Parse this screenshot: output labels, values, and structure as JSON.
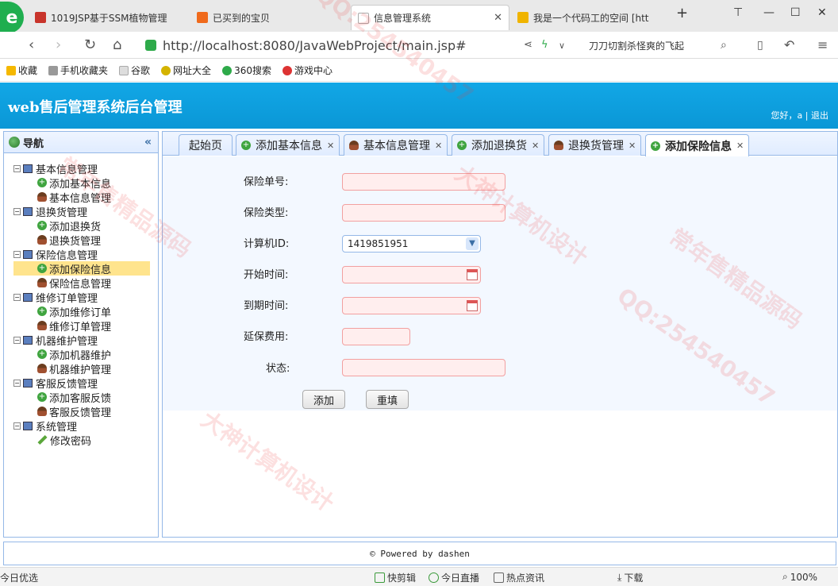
{
  "browser": {
    "tabs": [
      {
        "label": "1019JSP基于SSM植物管理",
        "color": "#c8342b"
      },
      {
        "label": "已买到的宝贝",
        "color": "#f06a1c"
      },
      {
        "label": "信息管理系统",
        "color": "#bbbbbb"
      },
      {
        "label": "我是一个代码工的空间 [htt",
        "color": "#f0b400"
      }
    ],
    "url": "http://localhost:8080/JavaWebProject/main.jsp#",
    "search_text": "刀刀切割杀怪爽的飞起"
  },
  "bookmarks": [
    {
      "label": "收藏",
      "color": "#f5b800"
    },
    {
      "label": "手机收藏夹",
      "color": "#999999"
    },
    {
      "label": "谷歌",
      "color": "#aaaaaa"
    },
    {
      "label": "网址大全",
      "color": "#d4b300"
    },
    {
      "label": "360搜索",
      "color": "#2eaa4a"
    },
    {
      "label": "游戏中心",
      "color": "#d33"
    }
  ],
  "app": {
    "title": "web售后管理系统后台管理",
    "user_greeting": "您好，a",
    "logout": "退出"
  },
  "sidebar": {
    "title": "导航",
    "collapse": "«",
    "groups": [
      {
        "label": "基本信息管理",
        "items": [
          "添加基本信息",
          "基本信息管理"
        ]
      },
      {
        "label": "退换货管理",
        "items": [
          "添加退换货",
          "退换货管理"
        ]
      },
      {
        "label": "保险信息管理",
        "items": [
          "添加保险信息",
          "保险信息管理"
        ]
      },
      {
        "label": "维修订单管理",
        "items": [
          "添加维修订单",
          "维修订单管理"
        ]
      },
      {
        "label": "机器维护管理",
        "items": [
          "添加机器维护",
          "机器维护管理"
        ]
      },
      {
        "label": "客服反馈管理",
        "items": [
          "添加客服反馈",
          "客服反馈管理"
        ]
      },
      {
        "label": "系统管理",
        "items": [
          "修改密码"
        ]
      }
    ]
  },
  "content_tabs": [
    {
      "label": "起始页"
    },
    {
      "label": "添加基本信息"
    },
    {
      "label": "基本信息管理"
    },
    {
      "label": "添加退换货"
    },
    {
      "label": "退换货管理"
    },
    {
      "label": "添加保险信息"
    }
  ],
  "form": {
    "policy_no_label": "保险单号:",
    "policy_type_label": "保险类型:",
    "computer_id_label": "计算机ID:",
    "computer_id_value": "1419851951",
    "start_time_label": "开始时间:",
    "end_time_label": "到期时间:",
    "extended_fee_label": "延保费用:",
    "status_label": "状态:",
    "add_button": "添加",
    "reset_button": "重填"
  },
  "footer": {
    "text": "© Powered by dashen"
  },
  "statusbar": {
    "left": "今日优选",
    "items": [
      "快剪辑",
      "今日直播",
      "热点资讯",
      "下载"
    ],
    "zoom": "100%"
  },
  "watermark": {
    "lines": [
      "大神计算机设计",
      "QQ:254540457",
      "常年售精品源码"
    ]
  }
}
